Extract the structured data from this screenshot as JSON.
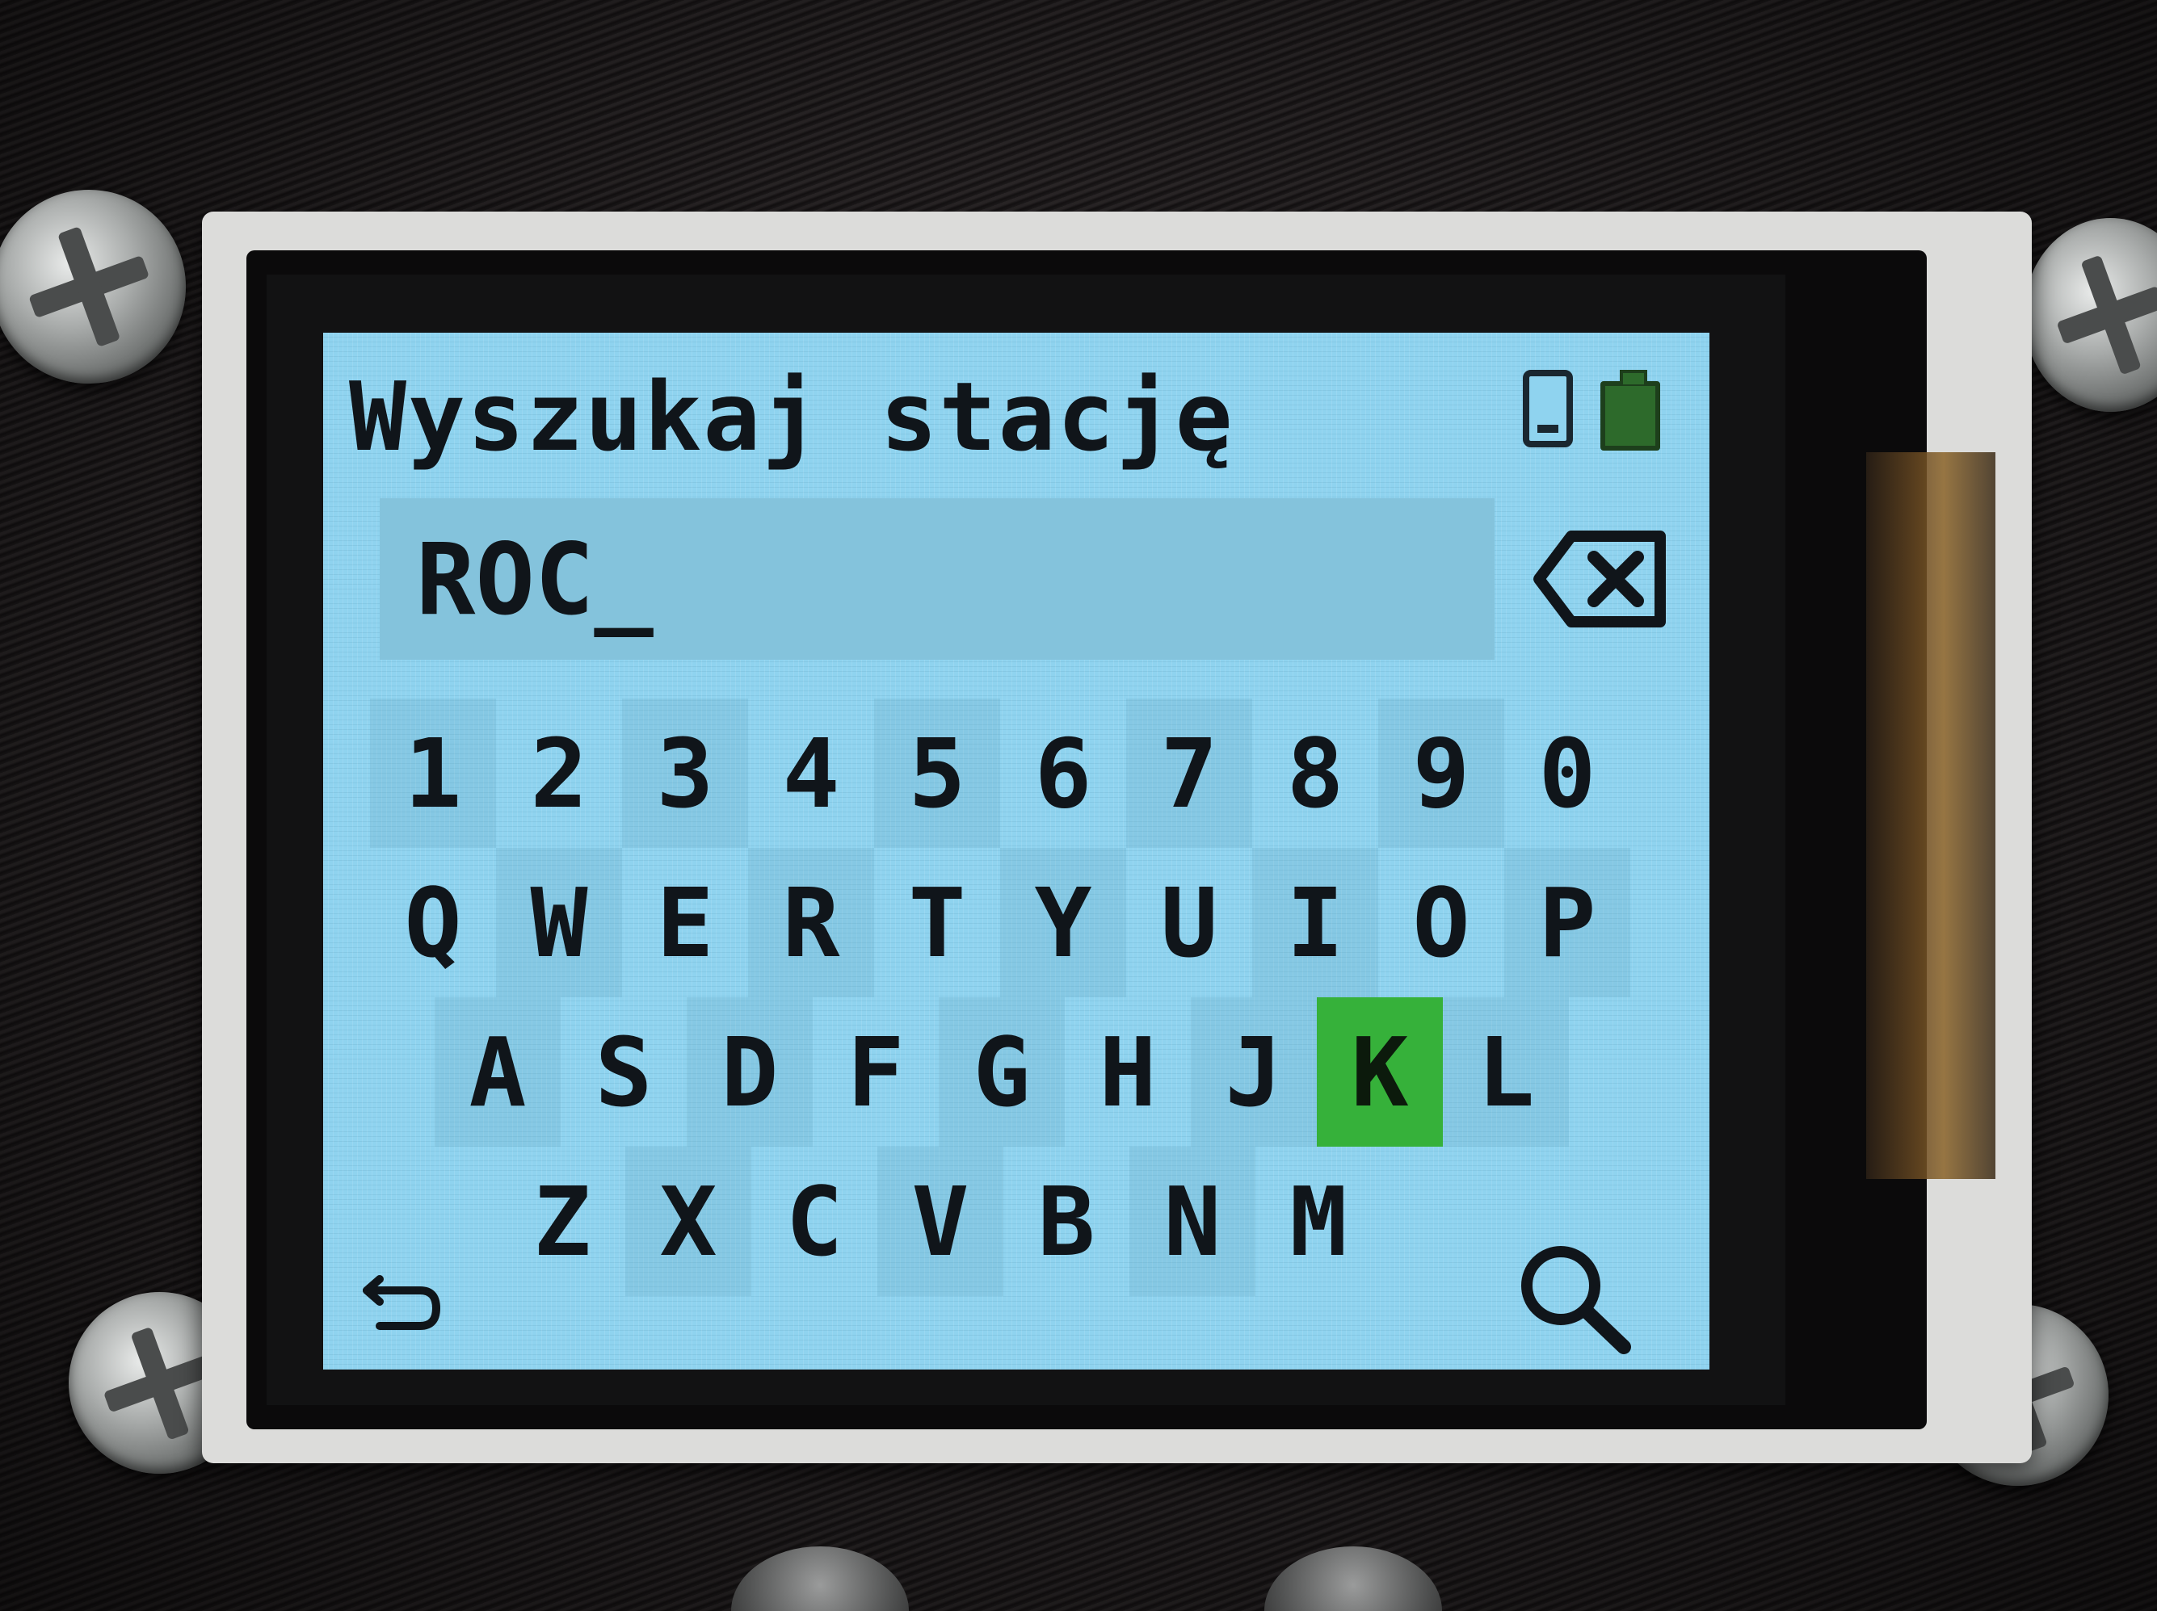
{
  "screen": {
    "title": "Wyszukaj stację",
    "status_icons": [
      "sd-card-icon",
      "battery-icon"
    ],
    "search_input": {
      "value": "ROC_"
    },
    "keyboard": {
      "rows": [
        [
          "1",
          "2",
          "3",
          "4",
          "5",
          "6",
          "7",
          "8",
          "9",
          "0"
        ],
        [
          "Q",
          "W",
          "E",
          "R",
          "T",
          "Y",
          "U",
          "I",
          "O",
          "P"
        ],
        [
          "A",
          "S",
          "D",
          "F",
          "G",
          "H",
          "J",
          "K",
          "L"
        ],
        [
          "Z",
          "X",
          "C",
          "V",
          "B",
          "N",
          "M"
        ]
      ],
      "selected_key": "K"
    },
    "controls": {
      "backspace_icon": "backspace-icon",
      "back_icon": "return-arrow-icon",
      "search_icon": "search-icon"
    }
  },
  "colors": {
    "lcd_background": "#8fd3ef",
    "selected_key": "#36b13a",
    "text": "#10151a"
  }
}
